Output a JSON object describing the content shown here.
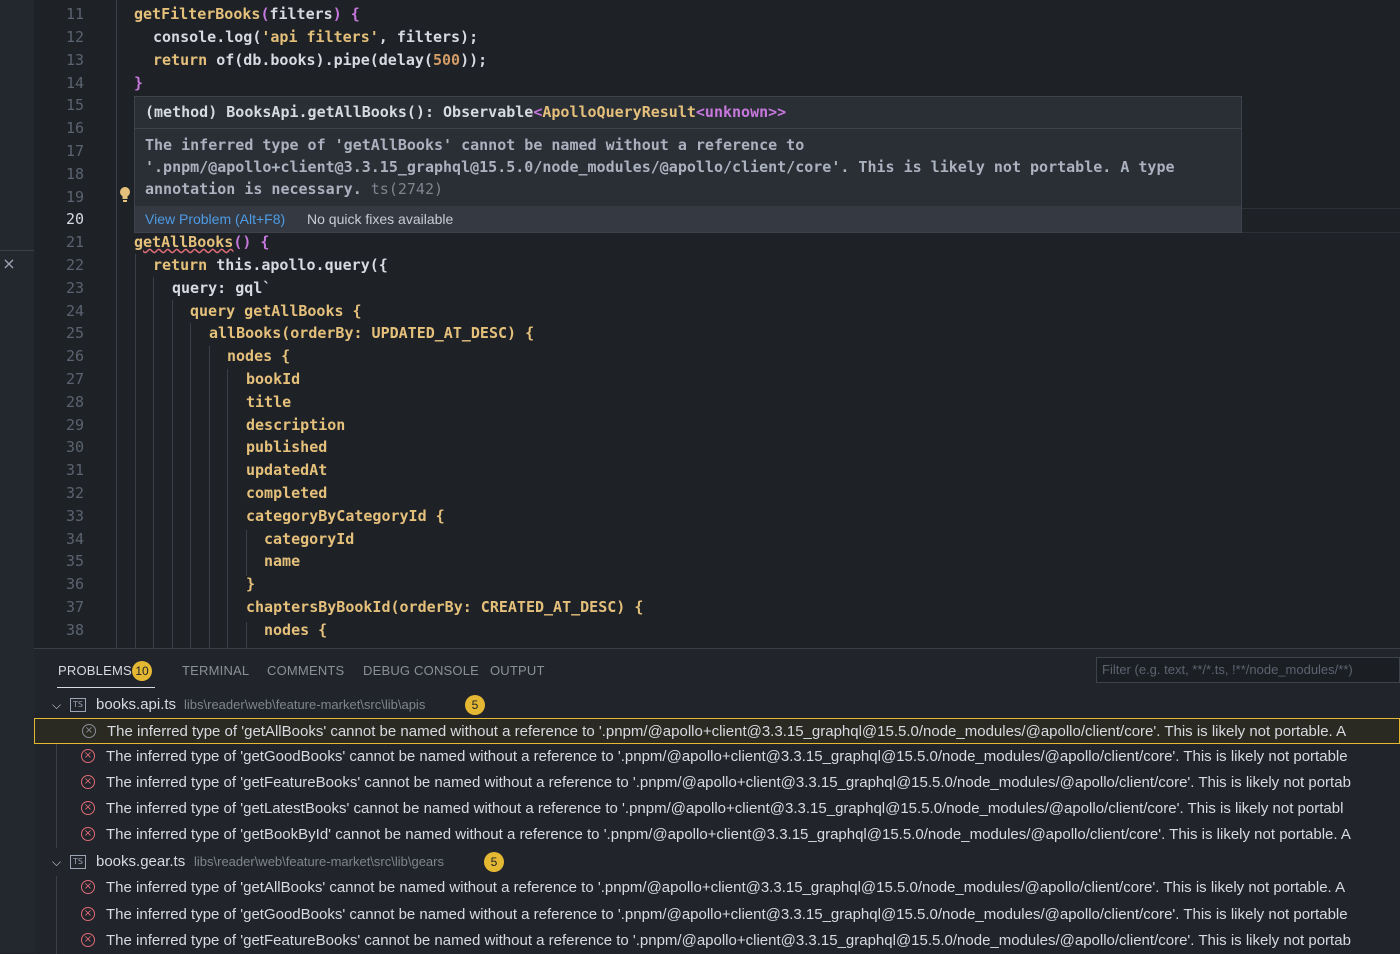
{
  "editor": {
    "lines": [
      {
        "n": "11"
      },
      {
        "n": "12"
      },
      {
        "n": "13"
      },
      {
        "n": "14"
      },
      {
        "n": "15"
      },
      {
        "n": "16"
      },
      {
        "n": "17"
      },
      {
        "n": "18"
      },
      {
        "n": "19"
      },
      {
        "n": "20"
      },
      {
        "n": "21"
      },
      {
        "n": "22"
      },
      {
        "n": "23"
      },
      {
        "n": "24"
      },
      {
        "n": "25"
      },
      {
        "n": "26"
      },
      {
        "n": "27"
      },
      {
        "n": "28"
      },
      {
        "n": "29"
      },
      {
        "n": "30"
      },
      {
        "n": "31"
      },
      {
        "n": "32"
      },
      {
        "n": "33"
      },
      {
        "n": "34"
      },
      {
        "n": "35"
      },
      {
        "n": "36"
      },
      {
        "n": "37"
      },
      {
        "n": "38"
      }
    ],
    "code": {
      "l11_fn": "getFilterBooks",
      "l11_arg": "filters",
      "l12": "console.log(",
      "l12_str": "'api filters'",
      "l12_end": ", filters);",
      "l13_kw": "return",
      "l13_rest": " of(db.books).pipe(delay(",
      "l13_num": "500",
      "l13_end": "));",
      "l14": "}",
      "l21_fn": "getAllBooks",
      "l21_rest": "() {",
      "l22_kw": "return",
      "l22_rest": " this.apollo.query({",
      "l23": "query: gql`",
      "l24": "query getAllBooks {",
      "l25": "allBooks(orderBy: UPDATED_AT_DESC) {",
      "l26": "nodes {",
      "l27": "bookId",
      "l28": "title",
      "l29": "description",
      "l30": "published",
      "l31": "updatedAt",
      "l32": "completed",
      "l33": "categoryByCategoryId {",
      "l34": "categoryId",
      "l35": "name",
      "l36": "}",
      "l37": "chaptersByBookId(orderBy: CREATED_AT_DESC) {",
      "l38": "nodes {"
    }
  },
  "hover": {
    "signature_prefix": "(method) BooksApi.getAllBooks(): Observable",
    "signature_lt": "<",
    "signature_type": "ApolloQueryResult",
    "signature_inner": "<unknown>>",
    "message_line1": "The inferred type of 'getAllBooks' cannot be named without a reference to",
    "message_line2": "'.pnpm/@apollo+client@3.3.15_graphql@15.5.0/node_modules/@apollo/client/core'. This is likely not portable. A type",
    "message_line3": "annotation is necessary. ",
    "error_code": "ts(2742)",
    "view_problem": "View Problem (Alt+F8)",
    "no_quick_fixes": "No quick fixes available"
  },
  "panel": {
    "tabs": {
      "problems": "PROBLEMS",
      "problems_count": "10",
      "terminal": "TERMINAL",
      "comments": "COMMENTS",
      "debug_console": "DEBUG CONSOLE",
      "output": "OUTPUT"
    },
    "filter_placeholder": "Filter (e.g. text, **/*.ts, !**/node_modules/**)",
    "groups": [
      {
        "file": "books.api.ts",
        "path": "libs\\reader\\web\\feature-market\\src\\lib\\apis",
        "count": "5",
        "errors": [
          "The inferred type of 'getAllBooks' cannot be named without a reference to '.pnpm/@apollo+client@3.3.15_graphql@15.5.0/node_modules/@apollo/client/core'. This is likely not portable. A",
          "The inferred type of 'getGoodBooks' cannot be named without a reference to '.pnpm/@apollo+client@3.3.15_graphql@15.5.0/node_modules/@apollo/client/core'. This is likely not portable",
          "The inferred type of 'getFeatureBooks' cannot be named without a reference to '.pnpm/@apollo+client@3.3.15_graphql@15.5.0/node_modules/@apollo/client/core'. This is likely not portab",
          "The inferred type of 'getLatestBooks' cannot be named without a reference to '.pnpm/@apollo+client@3.3.15_graphql@15.5.0/node_modules/@apollo/client/core'. This is likely not portabl",
          "The inferred type of 'getBookById' cannot be named without a reference to '.pnpm/@apollo+client@3.3.15_graphql@15.5.0/node_modules/@apollo/client/core'. This is likely not portable. A"
        ]
      },
      {
        "file": "books.gear.ts",
        "path": "libs\\reader\\web\\feature-market\\src\\lib\\gears",
        "count": "5",
        "errors": [
          "The inferred type of 'getAllBooks' cannot be named without a reference to '.pnpm/@apollo+client@3.3.15_graphql@15.5.0/node_modules/@apollo/client/core'. This is likely not portable. A",
          "The inferred type of 'getGoodBooks' cannot be named without a reference to '.pnpm/@apollo+client@3.3.15_graphql@15.5.0/node_modules/@apollo/client/core'. This is likely not portable",
          "The inferred type of 'getFeatureBooks' cannot be named without a reference to '.pnpm/@apollo+client@3.3.15_graphql@15.5.0/node_modules/@apollo/client/core'. This is likely not portab"
        ]
      }
    ]
  }
}
